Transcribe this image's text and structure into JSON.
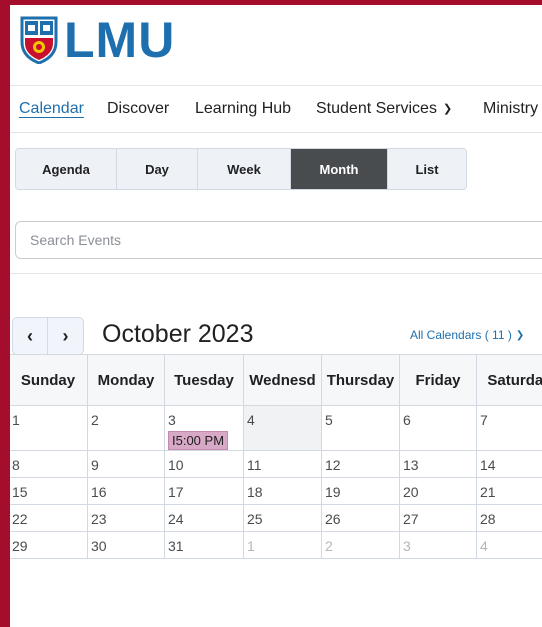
{
  "header": {
    "logo_text": "LMU"
  },
  "nav": {
    "items": [
      {
        "label": "Calendar",
        "active": true
      },
      {
        "label": "Discover"
      },
      {
        "label": "Learning Hub"
      },
      {
        "label": "Student Services",
        "dropdown": true
      },
      {
        "label": "Ministry"
      }
    ]
  },
  "views": {
    "tabs": [
      "Agenda",
      "Day",
      "Week",
      "Month",
      "List"
    ],
    "active": "Month"
  },
  "search": {
    "placeholder": "Search Events",
    "value": ""
  },
  "calendar": {
    "month_title": "October 2023",
    "all_calendars_label": "All Calendars ( 11 )",
    "weekdays": [
      "Sunday",
      "Monday",
      "Tuesday",
      "Wednesd",
      "Thursday",
      "Friday",
      "Saturday"
    ],
    "weeks": [
      [
        "1",
        "2",
        "3",
        "4",
        "5",
        "6",
        "7"
      ],
      [
        "8",
        "9",
        "10",
        "11",
        "12",
        "13",
        "14"
      ],
      [
        "15",
        "16",
        "17",
        "18",
        "19",
        "20",
        "21"
      ],
      [
        "22",
        "23",
        "24",
        "25",
        "26",
        "27",
        "28"
      ],
      [
        "29",
        "30",
        "31",
        "1",
        "2",
        "3",
        "4"
      ]
    ],
    "event": {
      "label": "I5:00 PM",
      "color": "#d8a9c6"
    }
  },
  "colors": {
    "brand_red": "#a50d2c",
    "brand_blue": "#1e6fae",
    "active_tab": "#494c4e"
  }
}
